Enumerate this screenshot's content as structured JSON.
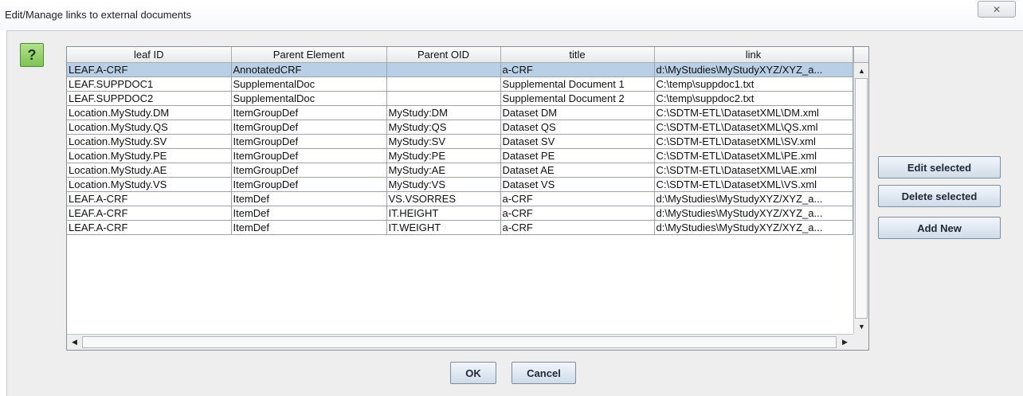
{
  "window": {
    "title": "Edit/Manage links to external documents",
    "close_icon": "close-icon",
    "close_glyph": "✕"
  },
  "help": {
    "label": "?",
    "icon": "help-icon"
  },
  "table": {
    "columns": [
      "leaf ID",
      "Parent Element",
      "Parent OID",
      "title",
      "link"
    ],
    "rows": [
      [
        "LEAF.A-CRF",
        "AnnotatedCRF",
        "",
        "a-CRF",
        "d:\\MyStudies\\MyStudyXYZ/XYZ_a..."
      ],
      [
        "LEAF.SUPPDOC1",
        "SupplementalDoc",
        "",
        "Supplemental Document 1",
        "C:\\temp\\suppdoc1.txt"
      ],
      [
        "LEAF.SUPPDOC2",
        "SupplementalDoc",
        "",
        "Supplemental Document 2",
        "C:\\temp\\suppdoc2.txt"
      ],
      [
        "Location.MyStudy.DM",
        "ItemGroupDef",
        "MyStudy:DM",
        "Dataset DM",
        "C:\\SDTM-ETL\\DatasetXML\\DM.xml"
      ],
      [
        "Location.MyStudy.QS",
        "ItemGroupDef",
        "MyStudy:QS",
        "Dataset QS",
        "C:\\SDTM-ETL\\DatasetXML\\QS.xml"
      ],
      [
        "Location.MyStudy.SV",
        "ItemGroupDef",
        "MyStudy:SV",
        "Dataset SV",
        "C:\\SDTM-ETL\\DatasetXML\\SV.xml"
      ],
      [
        "Location.MyStudy.PE",
        "ItemGroupDef",
        "MyStudy:PE",
        "Dataset PE",
        "C:\\SDTM-ETL\\DatasetXML\\PE.xml"
      ],
      [
        "Location.MyStudy.AE",
        "ItemGroupDef",
        "MyStudy:AE",
        "Dataset AE",
        "C:\\SDTM-ETL\\DatasetXML\\AE.xml"
      ],
      [
        "Location.MyStudy.VS",
        "ItemGroupDef",
        "MyStudy:VS",
        "Dataset VS",
        "C:\\SDTM-ETL\\DatasetXML\\VS.xml"
      ],
      [
        "LEAF.A-CRF",
        "ItemDef",
        "VS.VSORRES",
        "a-CRF",
        "d:\\MyStudies\\MyStudyXYZ/XYZ_a..."
      ],
      [
        "LEAF.A-CRF",
        "ItemDef",
        "IT.HEIGHT",
        "a-CRF",
        "d:\\MyStudies\\MyStudyXYZ/XYZ_a..."
      ],
      [
        "LEAF.A-CRF",
        "ItemDef",
        "IT.WEIGHT",
        "a-CRF",
        "d:\\MyStudies\\MyStudyXYZ/XYZ_a..."
      ]
    ],
    "selected_row": 0
  },
  "scrollbars": {
    "up_glyph": "▲",
    "down_glyph": "▼",
    "left_glyph": "◀",
    "right_glyph": "▶"
  },
  "actions": {
    "edit_selected": "Edit selected",
    "delete_selected": "Delete selected",
    "add_new": "Add New"
  },
  "dialog": {
    "ok": "OK",
    "cancel": "Cancel"
  },
  "colors": {
    "selection": "#b8cfe5",
    "help_green": "#7ec456",
    "button_border": "#7a8da3"
  }
}
